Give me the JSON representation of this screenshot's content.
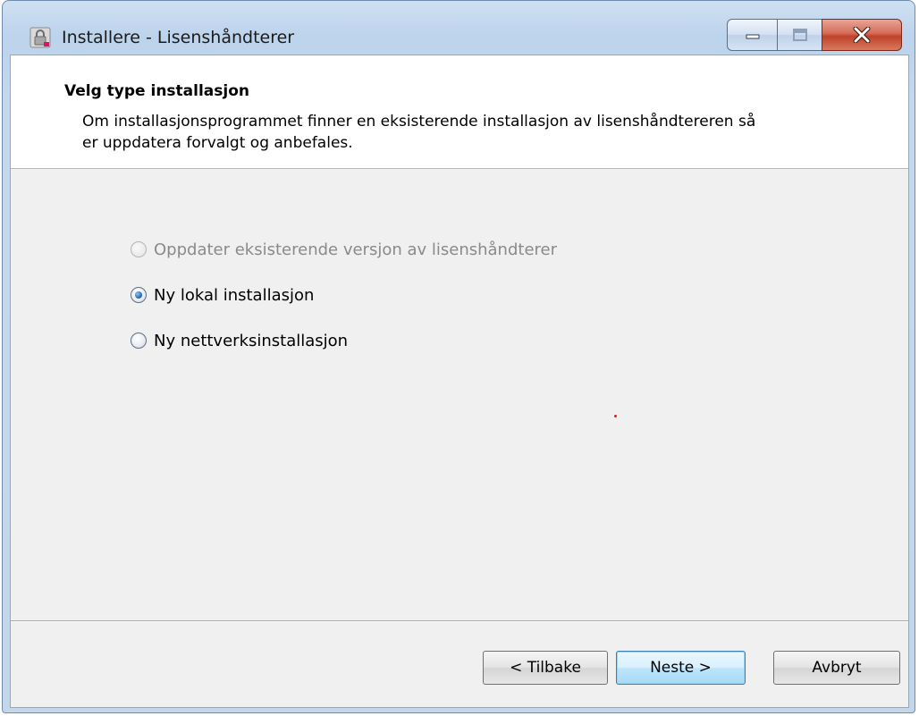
{
  "window": {
    "title": "Installere - Lisenshåndterer"
  },
  "header": {
    "title": "Velg type installasjon",
    "description": "Om installasjonsprogrammet finner en eksisterende installasjon av lisenshåndtereren så er uppdatera forvalgt og anbefales."
  },
  "options": [
    {
      "label": "Oppdater eksisterende versjon av lisenshåndterer",
      "checked": false,
      "enabled": false
    },
    {
      "label": "Ny lokal installasjon",
      "checked": true,
      "enabled": true
    },
    {
      "label": "Ny nettverksinstallasjon",
      "checked": false,
      "enabled": true
    }
  ],
  "buttons": {
    "back": "< Tilbake",
    "next": "Neste >",
    "cancel": "Avbryt"
  },
  "icons": {
    "app": "lock-icon",
    "minimize": "minimize-icon",
    "maximize": "maximize-icon",
    "close": "close-icon"
  },
  "colors": {
    "close_button": "#c0422a",
    "radio_selected": "#1a5fa8",
    "dot": "#e21b1b"
  }
}
